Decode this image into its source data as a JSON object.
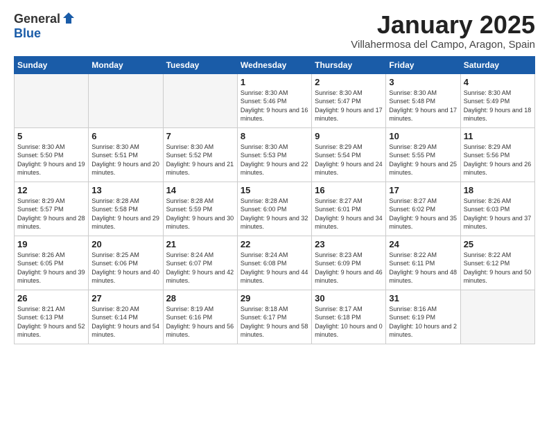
{
  "header": {
    "logo_general": "General",
    "logo_blue": "Blue",
    "month": "January 2025",
    "location": "Villahermosa del Campo, Aragon, Spain"
  },
  "weekdays": [
    "Sunday",
    "Monday",
    "Tuesday",
    "Wednesday",
    "Thursday",
    "Friday",
    "Saturday"
  ],
  "weeks": [
    [
      {
        "day": "",
        "info": ""
      },
      {
        "day": "",
        "info": ""
      },
      {
        "day": "",
        "info": ""
      },
      {
        "day": "1",
        "info": "Sunrise: 8:30 AM\nSunset: 5:46 PM\nDaylight: 9 hours\nand 16 minutes."
      },
      {
        "day": "2",
        "info": "Sunrise: 8:30 AM\nSunset: 5:47 PM\nDaylight: 9 hours\nand 17 minutes."
      },
      {
        "day": "3",
        "info": "Sunrise: 8:30 AM\nSunset: 5:48 PM\nDaylight: 9 hours\nand 17 minutes."
      },
      {
        "day": "4",
        "info": "Sunrise: 8:30 AM\nSunset: 5:49 PM\nDaylight: 9 hours\nand 18 minutes."
      }
    ],
    [
      {
        "day": "5",
        "info": "Sunrise: 8:30 AM\nSunset: 5:50 PM\nDaylight: 9 hours\nand 19 minutes."
      },
      {
        "day": "6",
        "info": "Sunrise: 8:30 AM\nSunset: 5:51 PM\nDaylight: 9 hours\nand 20 minutes."
      },
      {
        "day": "7",
        "info": "Sunrise: 8:30 AM\nSunset: 5:52 PM\nDaylight: 9 hours\nand 21 minutes."
      },
      {
        "day": "8",
        "info": "Sunrise: 8:30 AM\nSunset: 5:53 PM\nDaylight: 9 hours\nand 22 minutes."
      },
      {
        "day": "9",
        "info": "Sunrise: 8:29 AM\nSunset: 5:54 PM\nDaylight: 9 hours\nand 24 minutes."
      },
      {
        "day": "10",
        "info": "Sunrise: 8:29 AM\nSunset: 5:55 PM\nDaylight: 9 hours\nand 25 minutes."
      },
      {
        "day": "11",
        "info": "Sunrise: 8:29 AM\nSunset: 5:56 PM\nDaylight: 9 hours\nand 26 minutes."
      }
    ],
    [
      {
        "day": "12",
        "info": "Sunrise: 8:29 AM\nSunset: 5:57 PM\nDaylight: 9 hours\nand 28 minutes."
      },
      {
        "day": "13",
        "info": "Sunrise: 8:28 AM\nSunset: 5:58 PM\nDaylight: 9 hours\nand 29 minutes."
      },
      {
        "day": "14",
        "info": "Sunrise: 8:28 AM\nSunset: 5:59 PM\nDaylight: 9 hours\nand 30 minutes."
      },
      {
        "day": "15",
        "info": "Sunrise: 8:28 AM\nSunset: 6:00 PM\nDaylight: 9 hours\nand 32 minutes."
      },
      {
        "day": "16",
        "info": "Sunrise: 8:27 AM\nSunset: 6:01 PM\nDaylight: 9 hours\nand 34 minutes."
      },
      {
        "day": "17",
        "info": "Sunrise: 8:27 AM\nSunset: 6:02 PM\nDaylight: 9 hours\nand 35 minutes."
      },
      {
        "day": "18",
        "info": "Sunrise: 8:26 AM\nSunset: 6:03 PM\nDaylight: 9 hours\nand 37 minutes."
      }
    ],
    [
      {
        "day": "19",
        "info": "Sunrise: 8:26 AM\nSunset: 6:05 PM\nDaylight: 9 hours\nand 39 minutes."
      },
      {
        "day": "20",
        "info": "Sunrise: 8:25 AM\nSunset: 6:06 PM\nDaylight: 9 hours\nand 40 minutes."
      },
      {
        "day": "21",
        "info": "Sunrise: 8:24 AM\nSunset: 6:07 PM\nDaylight: 9 hours\nand 42 minutes."
      },
      {
        "day": "22",
        "info": "Sunrise: 8:24 AM\nSunset: 6:08 PM\nDaylight: 9 hours\nand 44 minutes."
      },
      {
        "day": "23",
        "info": "Sunrise: 8:23 AM\nSunset: 6:09 PM\nDaylight: 9 hours\nand 46 minutes."
      },
      {
        "day": "24",
        "info": "Sunrise: 8:22 AM\nSunset: 6:11 PM\nDaylight: 9 hours\nand 48 minutes."
      },
      {
        "day": "25",
        "info": "Sunrise: 8:22 AM\nSunset: 6:12 PM\nDaylight: 9 hours\nand 50 minutes."
      }
    ],
    [
      {
        "day": "26",
        "info": "Sunrise: 8:21 AM\nSunset: 6:13 PM\nDaylight: 9 hours\nand 52 minutes."
      },
      {
        "day": "27",
        "info": "Sunrise: 8:20 AM\nSunset: 6:14 PM\nDaylight: 9 hours\nand 54 minutes."
      },
      {
        "day": "28",
        "info": "Sunrise: 8:19 AM\nSunset: 6:16 PM\nDaylight: 9 hours\nand 56 minutes."
      },
      {
        "day": "29",
        "info": "Sunrise: 8:18 AM\nSunset: 6:17 PM\nDaylight: 9 hours\nand 58 minutes."
      },
      {
        "day": "30",
        "info": "Sunrise: 8:17 AM\nSunset: 6:18 PM\nDaylight: 10 hours\nand 0 minutes."
      },
      {
        "day": "31",
        "info": "Sunrise: 8:16 AM\nSunset: 6:19 PM\nDaylight: 10 hours\nand 2 minutes."
      },
      {
        "day": "",
        "info": ""
      }
    ]
  ]
}
